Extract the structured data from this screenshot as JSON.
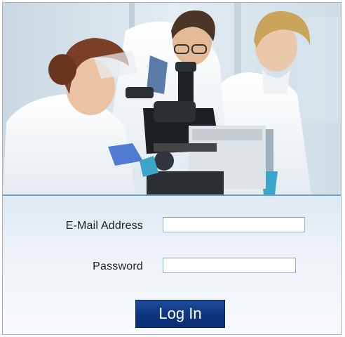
{
  "hero": {
    "image": "lab-scientists-microscope-photo"
  },
  "login_form": {
    "email_label": "E-Mail Address",
    "email_value": "",
    "password_label": "Password",
    "password_value": "",
    "submit_label": "Log In"
  },
  "colors": {
    "button_bg": "#0e3580",
    "border_accent": "#6fa2c8",
    "input_border": "#8fb2cf"
  }
}
